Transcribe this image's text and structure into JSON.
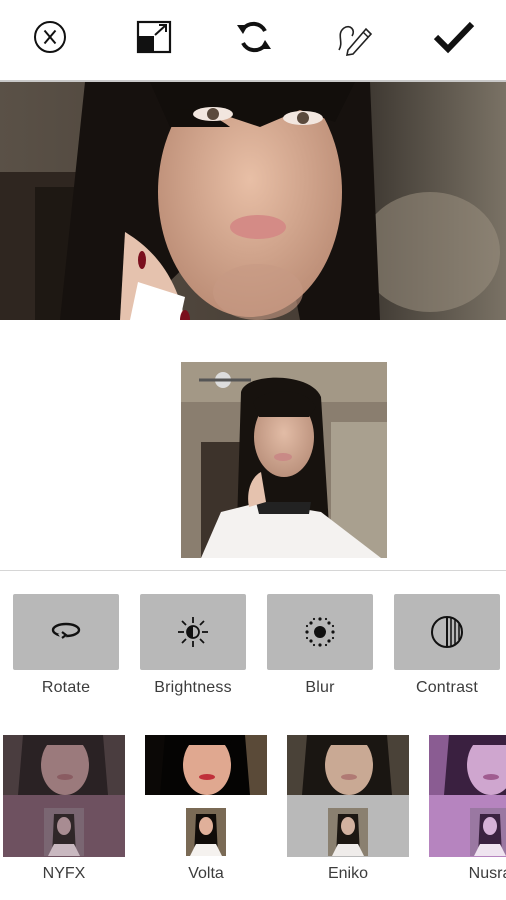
{
  "toolbar": {
    "buttons": [
      {
        "name": "cancel-button",
        "icon": "close-circle-icon"
      },
      {
        "name": "resize-button",
        "icon": "resize-icon"
      },
      {
        "name": "reset-button",
        "icon": "refresh-icon"
      },
      {
        "name": "draw-button",
        "icon": "pencil-squiggle-icon"
      },
      {
        "name": "apply-button",
        "icon": "checkmark-icon"
      }
    ]
  },
  "tools": [
    {
      "label": "Rotate",
      "icon": "rotate-icon"
    },
    {
      "label": "Brightness",
      "icon": "brightness-icon"
    },
    {
      "label": "Blur",
      "icon": "blur-icon"
    },
    {
      "label": "Contrast",
      "icon": "contrast-icon"
    }
  ],
  "filters": [
    {
      "label": "NYFX",
      "tint": "#6e5160"
    },
    {
      "label": "Volta",
      "tint": "#ffffff"
    },
    {
      "label": "Eniko",
      "tint": "#b9b9b9"
    },
    {
      "label": "Nusra",
      "tint": "#b684bf"
    }
  ],
  "colors": {
    "tool_bg": "#b8b8b8",
    "icon": "#111111"
  }
}
